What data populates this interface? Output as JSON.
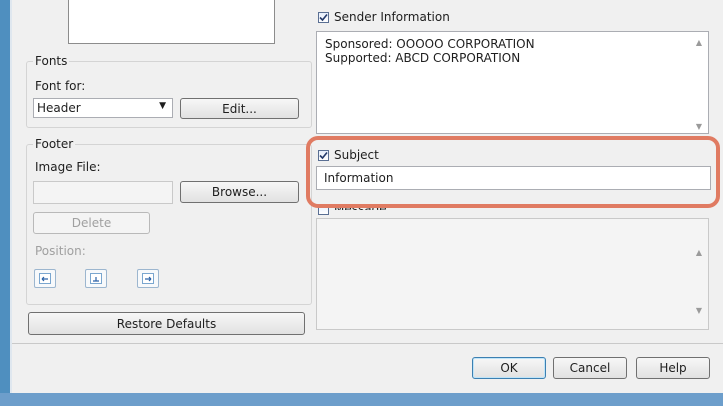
{
  "fonts": {
    "group_label": "Fonts",
    "font_for_label": "Font for:",
    "font_for_value": "Header",
    "edit_button": "Edit..."
  },
  "footer": {
    "group_label": "Footer",
    "image_file_label": "Image File:",
    "image_file_value": "",
    "browse_button": "Browse...",
    "delete_button": "Delete",
    "position_label": "Position:",
    "position_icons": [
      "align-left-icon",
      "align-center-icon",
      "align-right-icon"
    ]
  },
  "restore_defaults_button": "Restore Defaults",
  "sender": {
    "checkbox_label": "Sender Information",
    "checked": true,
    "lines": [
      "Sponsored: OOOOO CORPORATION",
      "Supported: ABCD CORPORATION"
    ]
  },
  "subject": {
    "checkbox_label": "Subject",
    "checked": true,
    "value": "Information"
  },
  "message": {
    "checkbox_label": "Message",
    "checked": false,
    "value": ""
  },
  "dialog_buttons": {
    "ok": "OK",
    "cancel": "Cancel",
    "help": "Help"
  },
  "colors": {
    "highlight": "#e07b62",
    "frame": "#4f8fbf"
  }
}
